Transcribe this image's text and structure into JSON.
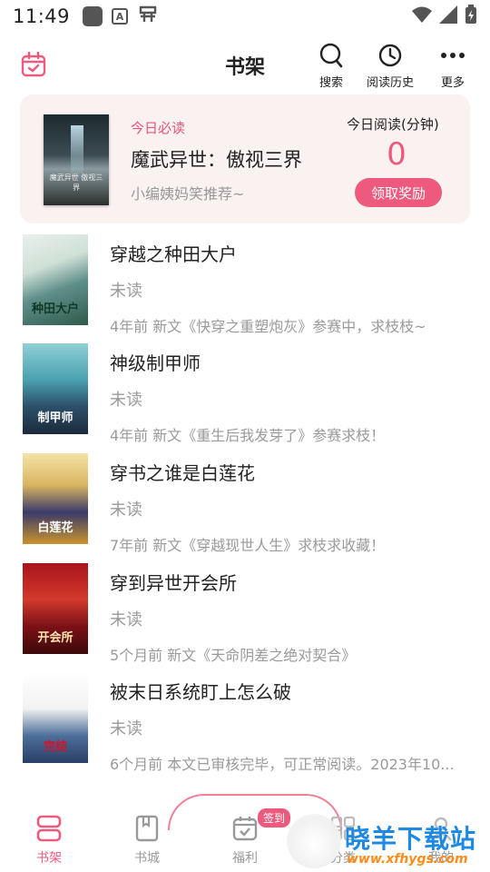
{
  "status_bar": {
    "time": "11:49",
    "icons": [
      "square-notification-icon",
      "a-notification-icon",
      "app-notification-icon",
      "wifi-icon",
      "signal-icon",
      "battery-charging-icon"
    ]
  },
  "header": {
    "title": "书架",
    "actions": [
      {
        "label": "搜索",
        "icon": "search-icon"
      },
      {
        "label": "阅读历史",
        "icon": "history-icon"
      },
      {
        "label": "更多",
        "icon": "more-icon"
      }
    ]
  },
  "daily": {
    "tag": "今日必读",
    "book_title": "魔武异世：傲视三界",
    "recommendation": "小编姨妈笑推荐~",
    "cover_text": "魔武异世 傲视三界",
    "read_label": "今日阅读(分钟)",
    "read_minutes": "0",
    "reward_button": "领取奖励"
  },
  "books": [
    {
      "title": "穿越之种田大户",
      "status": "未读",
      "update": "4年前 新文《快穿之重塑炮灰》参赛中，求枝枝~",
      "cover_text": "种田大户"
    },
    {
      "title": "神级制甲师",
      "status": "未读",
      "update": "4年前 新文《重生后我发芽了》参赛求枝！",
      "cover_text": "制甲师"
    },
    {
      "title": "穿书之谁是白莲花",
      "status": "未读",
      "update": "7年前 新文《穿越现世人生》求枝求收藏！",
      "cover_text": "白莲花"
    },
    {
      "title": "穿到异世开会所",
      "status": "未读",
      "update": "5个月前 新文《天命阴差之绝对契合》",
      "cover_text": "开会所"
    },
    {
      "title": "被末日系统盯上怎么破",
      "status": "未读",
      "update": "6个月前 本文已审核完毕，可正常阅读。2023年10...",
      "cover_text": "完结"
    }
  ],
  "bottom_nav": {
    "items": [
      {
        "label": "书架",
        "icon": "bookshelf-icon",
        "active": true
      },
      {
        "label": "书城",
        "icon": "bookstore-icon",
        "active": false
      },
      {
        "label": "福利",
        "icon": "welfare-calendar-icon",
        "active": false
      },
      {
        "label": "分类",
        "icon": "category-icon",
        "active": false
      },
      {
        "label": "我的",
        "icon": "profile-icon",
        "active": false
      }
    ],
    "sign_badge": "签到"
  },
  "watermark": {
    "main": "晓羊下载站",
    "url": "www.xfhygs.com"
  },
  "colors": {
    "accent": "#ee5a7d",
    "card_bg": "#faf1f1",
    "muted_text": "#9a9a9a",
    "watermark_blue": "#1e88e5",
    "watermark_orange": "#ff8c1a"
  }
}
